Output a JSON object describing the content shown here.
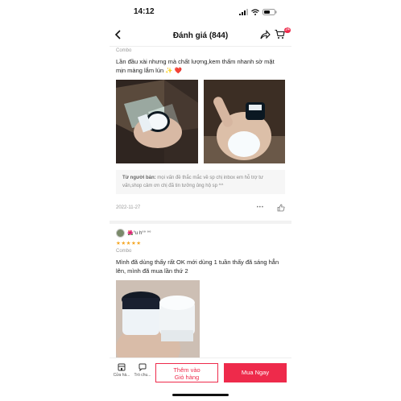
{
  "status_bar": {
    "time": "14:12"
  },
  "header": {
    "title": "Đánh giá (844)",
    "cart_count": "24"
  },
  "reviews": [
    {
      "variant": "Combo",
      "text": "Lần đầu xài nhưng mà chất lượng,kem thấm nhanh sờ mặt mịn màng lắm lún",
      "emoji": "✨ ❤️",
      "seller_reply_label": "Từ người bán:",
      "seller_reply": "mọi vấn đề thắc mắc về sp chị inbox em hỗ trợ tư vấn,shop cảm ơn chị đã tin tưởng ủng hộ sp ^^",
      "date": "2022-11-27",
      "more": "•••"
    },
    {
      "username": "🌺°u h°° °°",
      "stars": "★★★★★",
      "variant": "Combo",
      "text": "Mình đã dùng  thấy rất OK mới dùng 1 tuần thấy đã sáng hẳn lên, mình đã mua lần thứ 2"
    }
  ],
  "bottom_bar": {
    "shop_label": "Cửa hà...",
    "chat_label": "Trò chu...",
    "add_to_cart_line1": "Thêm vào",
    "add_to_cart_line2": "Giỏ hàng",
    "buy_now": "Mua Ngay"
  },
  "colors": {
    "accent": "#ee2a4b",
    "star": "#f5a623"
  },
  "icons": [
    "signal-icon",
    "wifi-icon",
    "battery-icon",
    "back-arrow-icon",
    "share-icon",
    "cart-icon",
    "like-icon",
    "shop-icon",
    "chat-icon"
  ]
}
